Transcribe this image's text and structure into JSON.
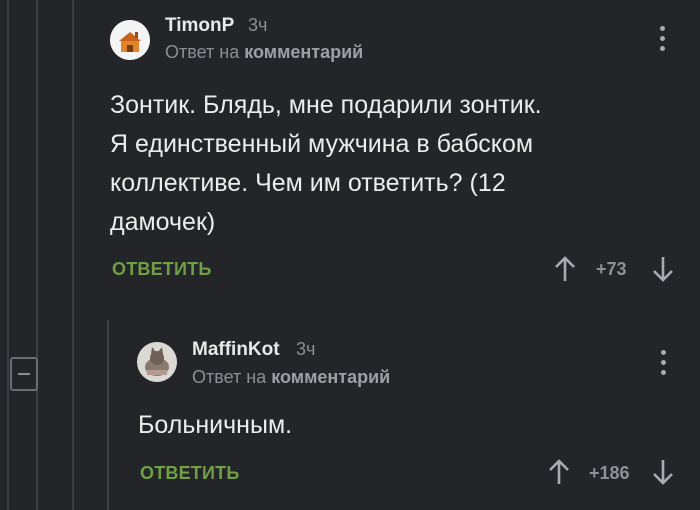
{
  "comments": [
    {
      "author": "TimonP",
      "time": "3ч",
      "reply_prefix": "Ответ на",
      "reply_target": "комментарий",
      "lines": [
        "Зонтик. Блядь, мне подарили зонтик.",
        "Я единственный мужчина в бабском",
        "коллективе. Чем им ответить? (12",
        "дамочек)"
      ],
      "reply_label": "ОТВЕТИТЬ",
      "score": "+73"
    },
    {
      "author": "MaffinKot",
      "time": "3ч",
      "reply_prefix": "Ответ на",
      "reply_target": "комментарий",
      "lines": [
        "Больничным."
      ],
      "reply_label": "ОТВЕТИТЬ",
      "score": "+186"
    }
  ],
  "colors": {
    "background": "#232528",
    "accent_green": "#6fa046",
    "muted": "#8b8e92"
  },
  "icons": [
    "house-avatar",
    "cat-avatar",
    "more-vertical-icon",
    "arrow-up-icon",
    "arrow-down-icon",
    "collapse-icon"
  ]
}
